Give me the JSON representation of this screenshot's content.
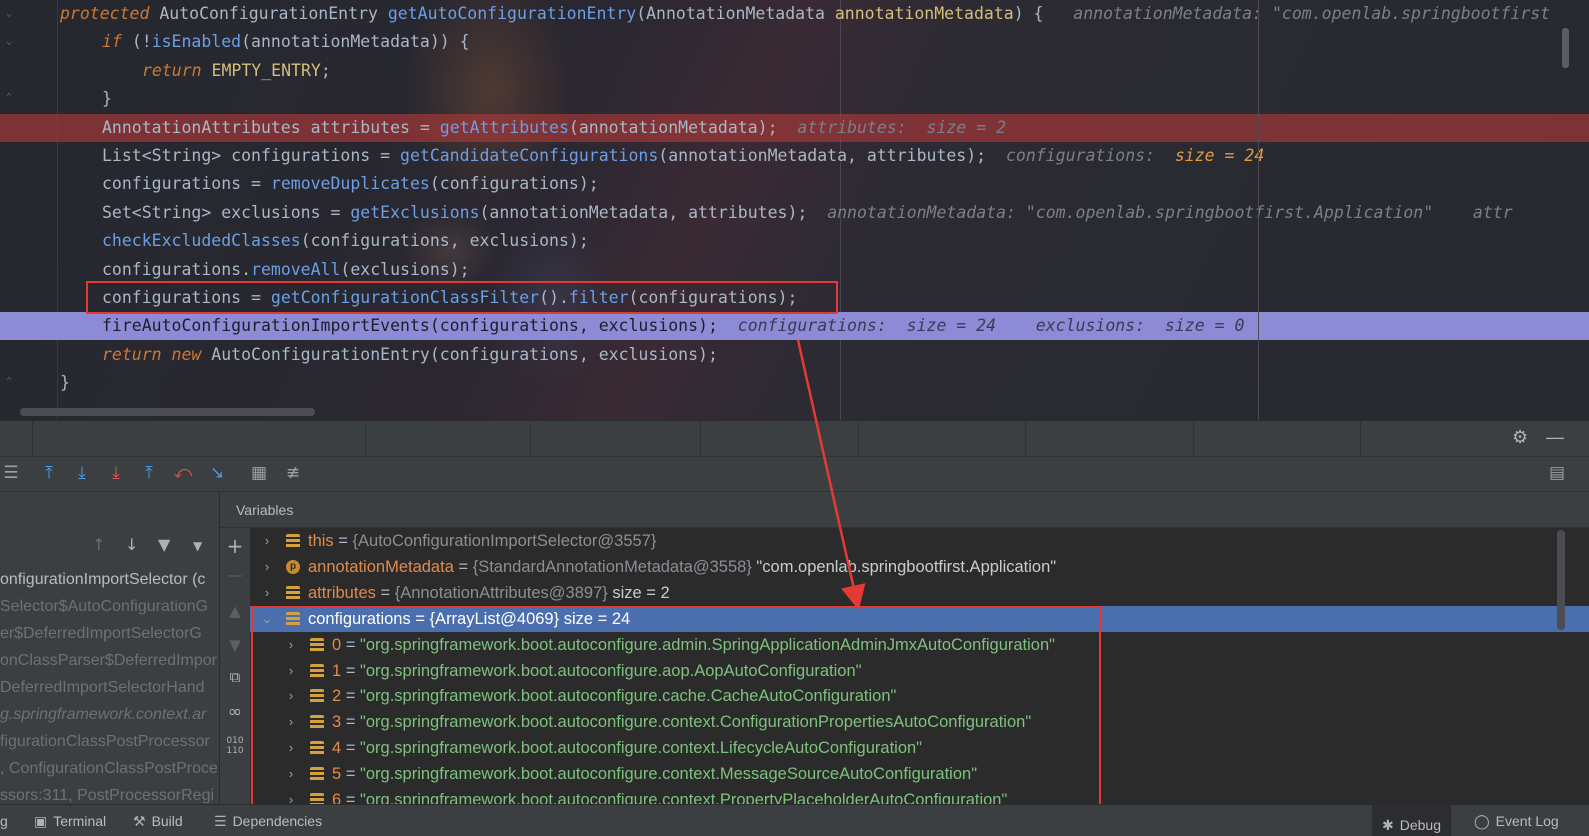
{
  "editor": {
    "lines": [
      {
        "kind": "sig",
        "parts": [
          [
            "kw",
            "protected "
          ],
          [
            "t",
            "AutoConfigurationEntry "
          ],
          [
            "m",
            "getAutoConfigurationEntry"
          ],
          [
            "t",
            "(AnnotationMetadata "
          ],
          [
            "p",
            "annotationMetadata"
          ],
          [
            "t",
            ") {   "
          ],
          [
            "hint",
            "annotationMetadata: \"com.openlab.springbootfirst"
          ]
        ]
      },
      {
        "kind": "n1",
        "parts": [
          [
            "kw",
            "if "
          ],
          [
            "t",
            "(!"
          ],
          [
            "m",
            "isEnabled"
          ],
          [
            "t",
            "(annotationMetadata)) {"
          ]
        ]
      },
      {
        "kind": "n2",
        "parts": [
          [
            "kw",
            "return "
          ],
          [
            "p",
            "EMPTY_ENTRY"
          ],
          [
            "t",
            ";"
          ]
        ]
      },
      {
        "kind": "n1",
        "parts": [
          [
            "t",
            "}"
          ]
        ]
      },
      {
        "kind": "bp",
        "parts": [
          [
            "t",
            "AnnotationAttributes attributes = "
          ],
          [
            "m",
            "getAttributes"
          ],
          [
            "t",
            "(annotationMetadata);  "
          ],
          [
            "hint",
            "attributes:  size = 2"
          ]
        ]
      },
      {
        "kind": "n1",
        "parts": [
          [
            "t",
            "List<String> configurations = "
          ],
          [
            "m",
            "getCandidateConfigurations"
          ],
          [
            "t",
            "(annotationMetadata, attributes);  "
          ],
          [
            "hint",
            "configurations:  "
          ],
          [
            "hinto",
            "size = 24"
          ]
        ]
      },
      {
        "kind": "n1",
        "parts": [
          [
            "t",
            "configurations = "
          ],
          [
            "m",
            "removeDuplicates"
          ],
          [
            "t",
            "(configurations);"
          ]
        ]
      },
      {
        "kind": "n1",
        "parts": [
          [
            "t",
            "Set<String> exclusions = "
          ],
          [
            "m",
            "getExclusions"
          ],
          [
            "t",
            "(annotationMetadata, attributes);  "
          ],
          [
            "hint",
            "annotationMetadata: \"com.openlab.springbootfirst.Application\"    attr"
          ]
        ]
      },
      {
        "kind": "n1",
        "parts": [
          [
            "m",
            "checkExcludedClasses"
          ],
          [
            "t",
            "(configurations, exclusions);"
          ]
        ]
      },
      {
        "kind": "n1",
        "parts": [
          [
            "t",
            "configurations."
          ],
          [
            "m",
            "removeAll"
          ],
          [
            "t",
            "(exclusions);"
          ]
        ]
      },
      {
        "kind": "n1",
        "parts": [
          [
            "t",
            "configurations = "
          ],
          [
            "m",
            "getConfigurationClassFilter"
          ],
          [
            "t",
            "()."
          ],
          [
            "m",
            "filter"
          ],
          [
            "t",
            "(configurations);"
          ]
        ]
      },
      {
        "kind": "cur",
        "parts": [
          [
            "t",
            "fireAutoConfigurationImportEvents(configurations, exclusions);  "
          ],
          [
            "hint",
            "configurations:  size = 24    exclusions:  size = 0"
          ]
        ]
      },
      {
        "kind": "n1",
        "parts": [
          [
            "kw",
            "return new "
          ],
          [
            "t",
            "AutoConfigurationEntry(configurations, exclusions);"
          ]
        ]
      },
      {
        "kind": "n0",
        "parts": [
          [
            "t",
            "}"
          ]
        ]
      }
    ]
  },
  "debugger": {
    "variables_title": "Variables",
    "frames": [
      {
        "text": "onfigurationImportSelector (c",
        "style": "first"
      },
      {
        "text": "Selector$AutoConfigurationG",
        "style": ""
      },
      {
        "text": "er$DeferredImportSelectorG",
        "style": ""
      },
      {
        "text": "onClassParser$DeferredImpor",
        "style": ""
      },
      {
        "text": "DeferredImportSelectorHand",
        "style": ""
      },
      {
        "text": "g.springframework.context.ar",
        "style": "it"
      },
      {
        "text": "figurationClassPostProcessor",
        "style": ""
      },
      {
        "text": ", ConfigurationClassPostProce",
        "style": ""
      },
      {
        "text": "ssors:311, PostProcessorRegi",
        "style": ""
      }
    ],
    "variables": [
      {
        "level": 0,
        "arrow": "›",
        "icon": "field",
        "name": "this",
        "ref": "{AutoConfigurationImportSelector@3557}",
        "extra": ""
      },
      {
        "level": 0,
        "arrow": "›",
        "icon": "param",
        "name": "annotationMetadata",
        "ref": "{StandardAnnotationMetadata@3558}",
        "extra": "\"com.openlab.springbootfirst.Application\""
      },
      {
        "level": 0,
        "arrow": "›",
        "icon": "field",
        "name": "attributes",
        "ref": "{AnnotationAttributes@3897}",
        "extra": "size = 2"
      },
      {
        "level": 0,
        "arrow": "⌄",
        "icon": "field",
        "name": "configurations",
        "ref": "{ArrayList@4069}",
        "extra": "size = 24",
        "selected": true
      },
      {
        "level": 1,
        "arrow": "›",
        "icon": "field",
        "index": "0",
        "value": "\"org.springframework.boot.autoconfigure.admin.SpringApplicationAdminJmxAutoConfiguration\""
      },
      {
        "level": 1,
        "arrow": "›",
        "icon": "field",
        "index": "1",
        "value": "\"org.springframework.boot.autoconfigure.aop.AopAutoConfiguration\""
      },
      {
        "level": 1,
        "arrow": "›",
        "icon": "field",
        "index": "2",
        "value": "\"org.springframework.boot.autoconfigure.cache.CacheAutoConfiguration\""
      },
      {
        "level": 1,
        "arrow": "›",
        "icon": "field",
        "index": "3",
        "value": "\"org.springframework.boot.autoconfigure.context.ConfigurationPropertiesAutoConfiguration\""
      },
      {
        "level": 1,
        "arrow": "›",
        "icon": "field",
        "index": "4",
        "value": "\"org.springframework.boot.autoconfigure.context.LifecycleAutoConfiguration\""
      },
      {
        "level": 1,
        "arrow": "›",
        "icon": "field",
        "index": "5",
        "value": "\"org.springframework.boot.autoconfigure.context.MessageSourceAutoConfiguration\""
      },
      {
        "level": 1,
        "arrow": "›",
        "icon": "field",
        "index": "6",
        "value": "\"org.springframework.boot.autoconfigure.context.PropertyPlaceholderAutoConfiguration\""
      }
    ]
  },
  "statusbar": {
    "left_fragment": "g",
    "terminal": "Terminal",
    "build": "Build",
    "dependencies": "Dependencies",
    "debug": "Debug",
    "event_log": "Event Log"
  },
  "annotation": {
    "color": "#e53935"
  }
}
